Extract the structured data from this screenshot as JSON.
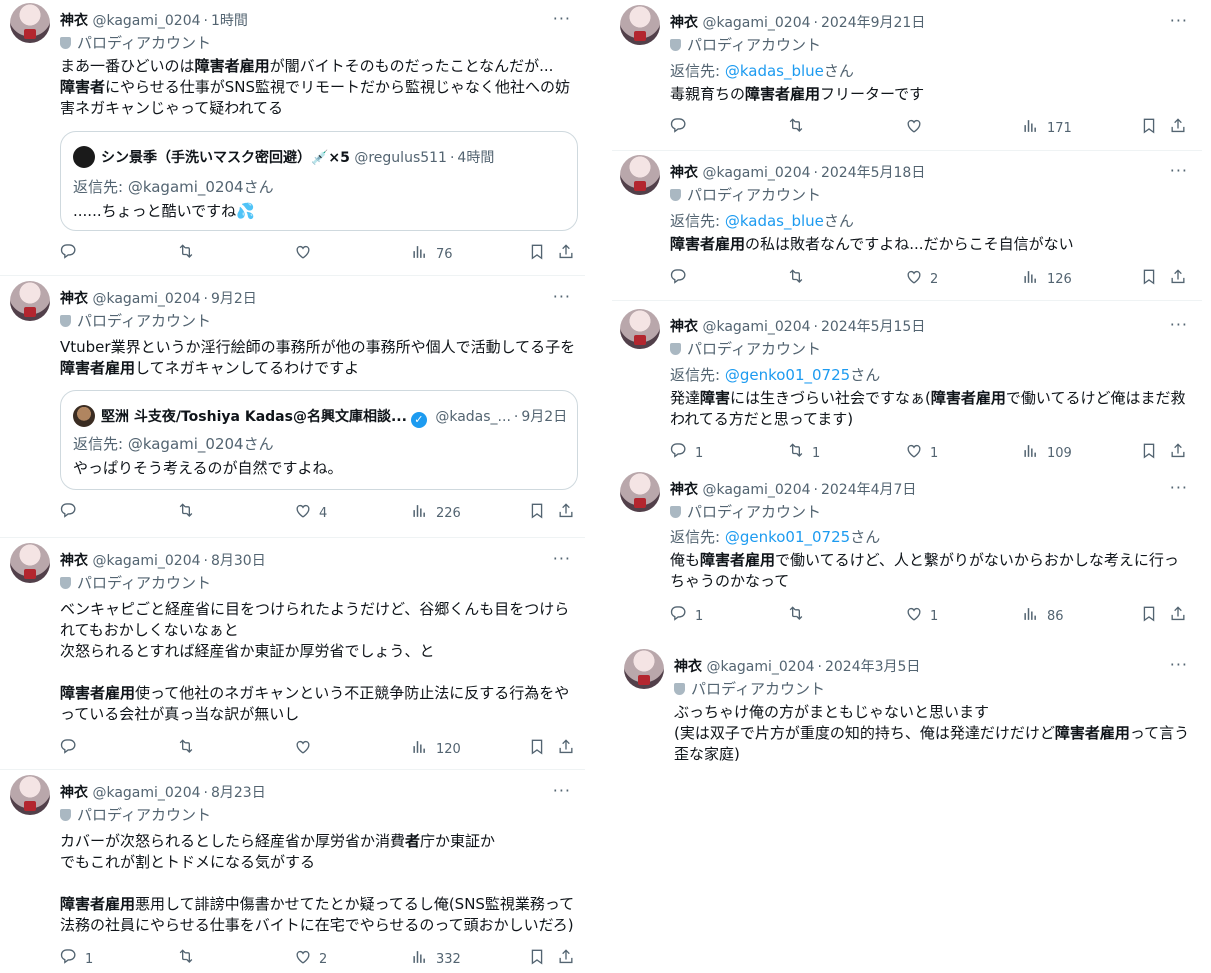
{
  "common": {
    "display_name": "神衣",
    "handle": "@kagami_0204",
    "parody_label": "パロディアカウント",
    "dot": "·",
    "more": "···",
    "reply_prefix": "返信先: ",
    "reply_suffix": "さん"
  },
  "left": [
    {
      "time": "1時間",
      "lines": [
        [
          "まあ一番ひどいのは",
          {
            "b": "障害者雇用"
          },
          "が闇バイトそのものだったことなんだが..."
        ],
        [
          {
            "b": "障害者"
          },
          "にやらせる仕事がSNS監視でリモートだから監視じゃなく他社への妨"
        ],
        [
          "害ネガキャンじゃって疑われてる"
        ]
      ],
      "quote": {
        "name": "シン景季（手洗いマスク密回避）💉×5",
        "handle": "@regulus511",
        "time": "4時間",
        "reply_to": "返信先: @kagami_0204さん",
        "text": "......ちょっと酷いですね💦"
      },
      "counts": {
        "reply": "",
        "retweet": "",
        "like": "",
        "views": "76"
      }
    },
    {
      "time": "9月2日",
      "lines": [
        [
          "Vtuber業界というか淫行絵師の事務所が他の事務所や個人で活動してる子を"
        ],
        [
          {
            "b": "障害者雇用"
          },
          "してネガキャンしてるわけですよ"
        ]
      ],
      "quote": {
        "name": "堅洲 斗支夜/Toshiya Kadas@名興文庫相談...",
        "handle": "@kadas_...",
        "time": "9月2日",
        "reply_to": "返信先: @kagami_0204さん",
        "text": "やっぱりそう考えるのが自然ですよね。"
      },
      "counts": {
        "reply": "",
        "retweet": "",
        "like": "4",
        "views": "226"
      }
    },
    {
      "time": "8月30日",
      "lines": [
        [
          "ベンキャピごと経産省に目をつけられたようだけど、谷郷くんも目をつけら"
        ],
        [
          "れてもおかしくないなぁと"
        ],
        [
          "次怒られるとすれば経産省か東証か厚労省でしょう、と"
        ],
        [
          ""
        ],
        [
          {
            "b": "障害者雇用"
          },
          "使って他社のネガキャンという不正競争防止法に反する行為をや"
        ],
        [
          "っている会社が真っ当な訳が無いし"
        ]
      ],
      "counts": {
        "reply": "",
        "retweet": "",
        "like": "",
        "views": "120"
      }
    },
    {
      "time": "8月23日",
      "lines": [
        [
          "カバーが次怒られるとしたら経産省か厚労省か消費",
          {
            "b": "者"
          },
          "庁か東証か"
        ],
        [
          "でもこれが割とトドメになる気がする"
        ],
        [
          ""
        ],
        [
          {
            "b": "障害者雇用"
          },
          "悪用して誹謗中傷書かせてたとか疑ってるし俺(SNS監視業務って"
        ],
        [
          "法務の社員にやらせる仕事をバイトに在宅でやらせるのって頭おかしいだろ)"
        ]
      ],
      "counts": {
        "reply": "1",
        "retweet": "",
        "like": "2",
        "views": "332"
      }
    }
  ],
  "right": [
    {
      "time": "2024年9月21日",
      "reply_mention": "@kadas_blue",
      "lines": [
        [
          "毒親育ちの",
          {
            "b": "障害者雇用"
          },
          "フリーターです"
        ]
      ],
      "counts": {
        "reply": "",
        "retweet": "",
        "like": "",
        "views": "171"
      }
    },
    {
      "time": "2024年5月18日",
      "reply_mention": "@kadas_blue",
      "lines": [
        [
          {
            "b": "障害者雇用"
          },
          "の私は敗者なんですよね...だからこそ自信がない"
        ]
      ],
      "counts": {
        "reply": "",
        "retweet": "",
        "like": "2",
        "views": "126"
      }
    },
    {
      "time": "2024年5月15日",
      "reply_mention": "@genko01_0725",
      "lines": [
        [
          "発達",
          {
            "b": "障害"
          },
          "には生きづらい社会ですなぁ(",
          {
            "b": "障害者雇用"
          },
          "で働いてるけど俺はまだ救"
        ],
        [
          "われてる方だと思ってます)"
        ]
      ],
      "counts": {
        "reply": "1",
        "retweet": "1",
        "like": "1",
        "views": "109"
      }
    },
    {
      "time": "2024年4月7日",
      "reply_mention": "@genko01_0725",
      "lines": [
        [
          "俺も",
          {
            "b": "障害者雇用"
          },
          "で働いてるけど、人と繋がりがないからおかしな考えに行っ"
        ],
        [
          "ちゃうのかなって"
        ]
      ],
      "counts": {
        "reply": "1",
        "retweet": "",
        "like": "1",
        "views": "86"
      }
    },
    {
      "time": "2024年3月5日",
      "lines": [
        [
          "ぶっちゃけ俺の方がまともじゃないと思います"
        ],
        [
          "(実は双子で片方が重度の知的持ち、俺は発達だけだけど",
          {
            "b": "障害者雇用"
          },
          "って言う"
        ],
        [
          "歪な家庭)"
        ]
      ]
    }
  ],
  "icons": {
    "reply": "reply-icon",
    "retweet": "retweet-icon",
    "like": "heart-icon",
    "views": "views-icon",
    "bookmark": "bookmark-icon",
    "share": "share-icon"
  },
  "colors": {
    "mention": "#1d9bf0",
    "muted": "#536471",
    "border": "#cfd9de"
  }
}
